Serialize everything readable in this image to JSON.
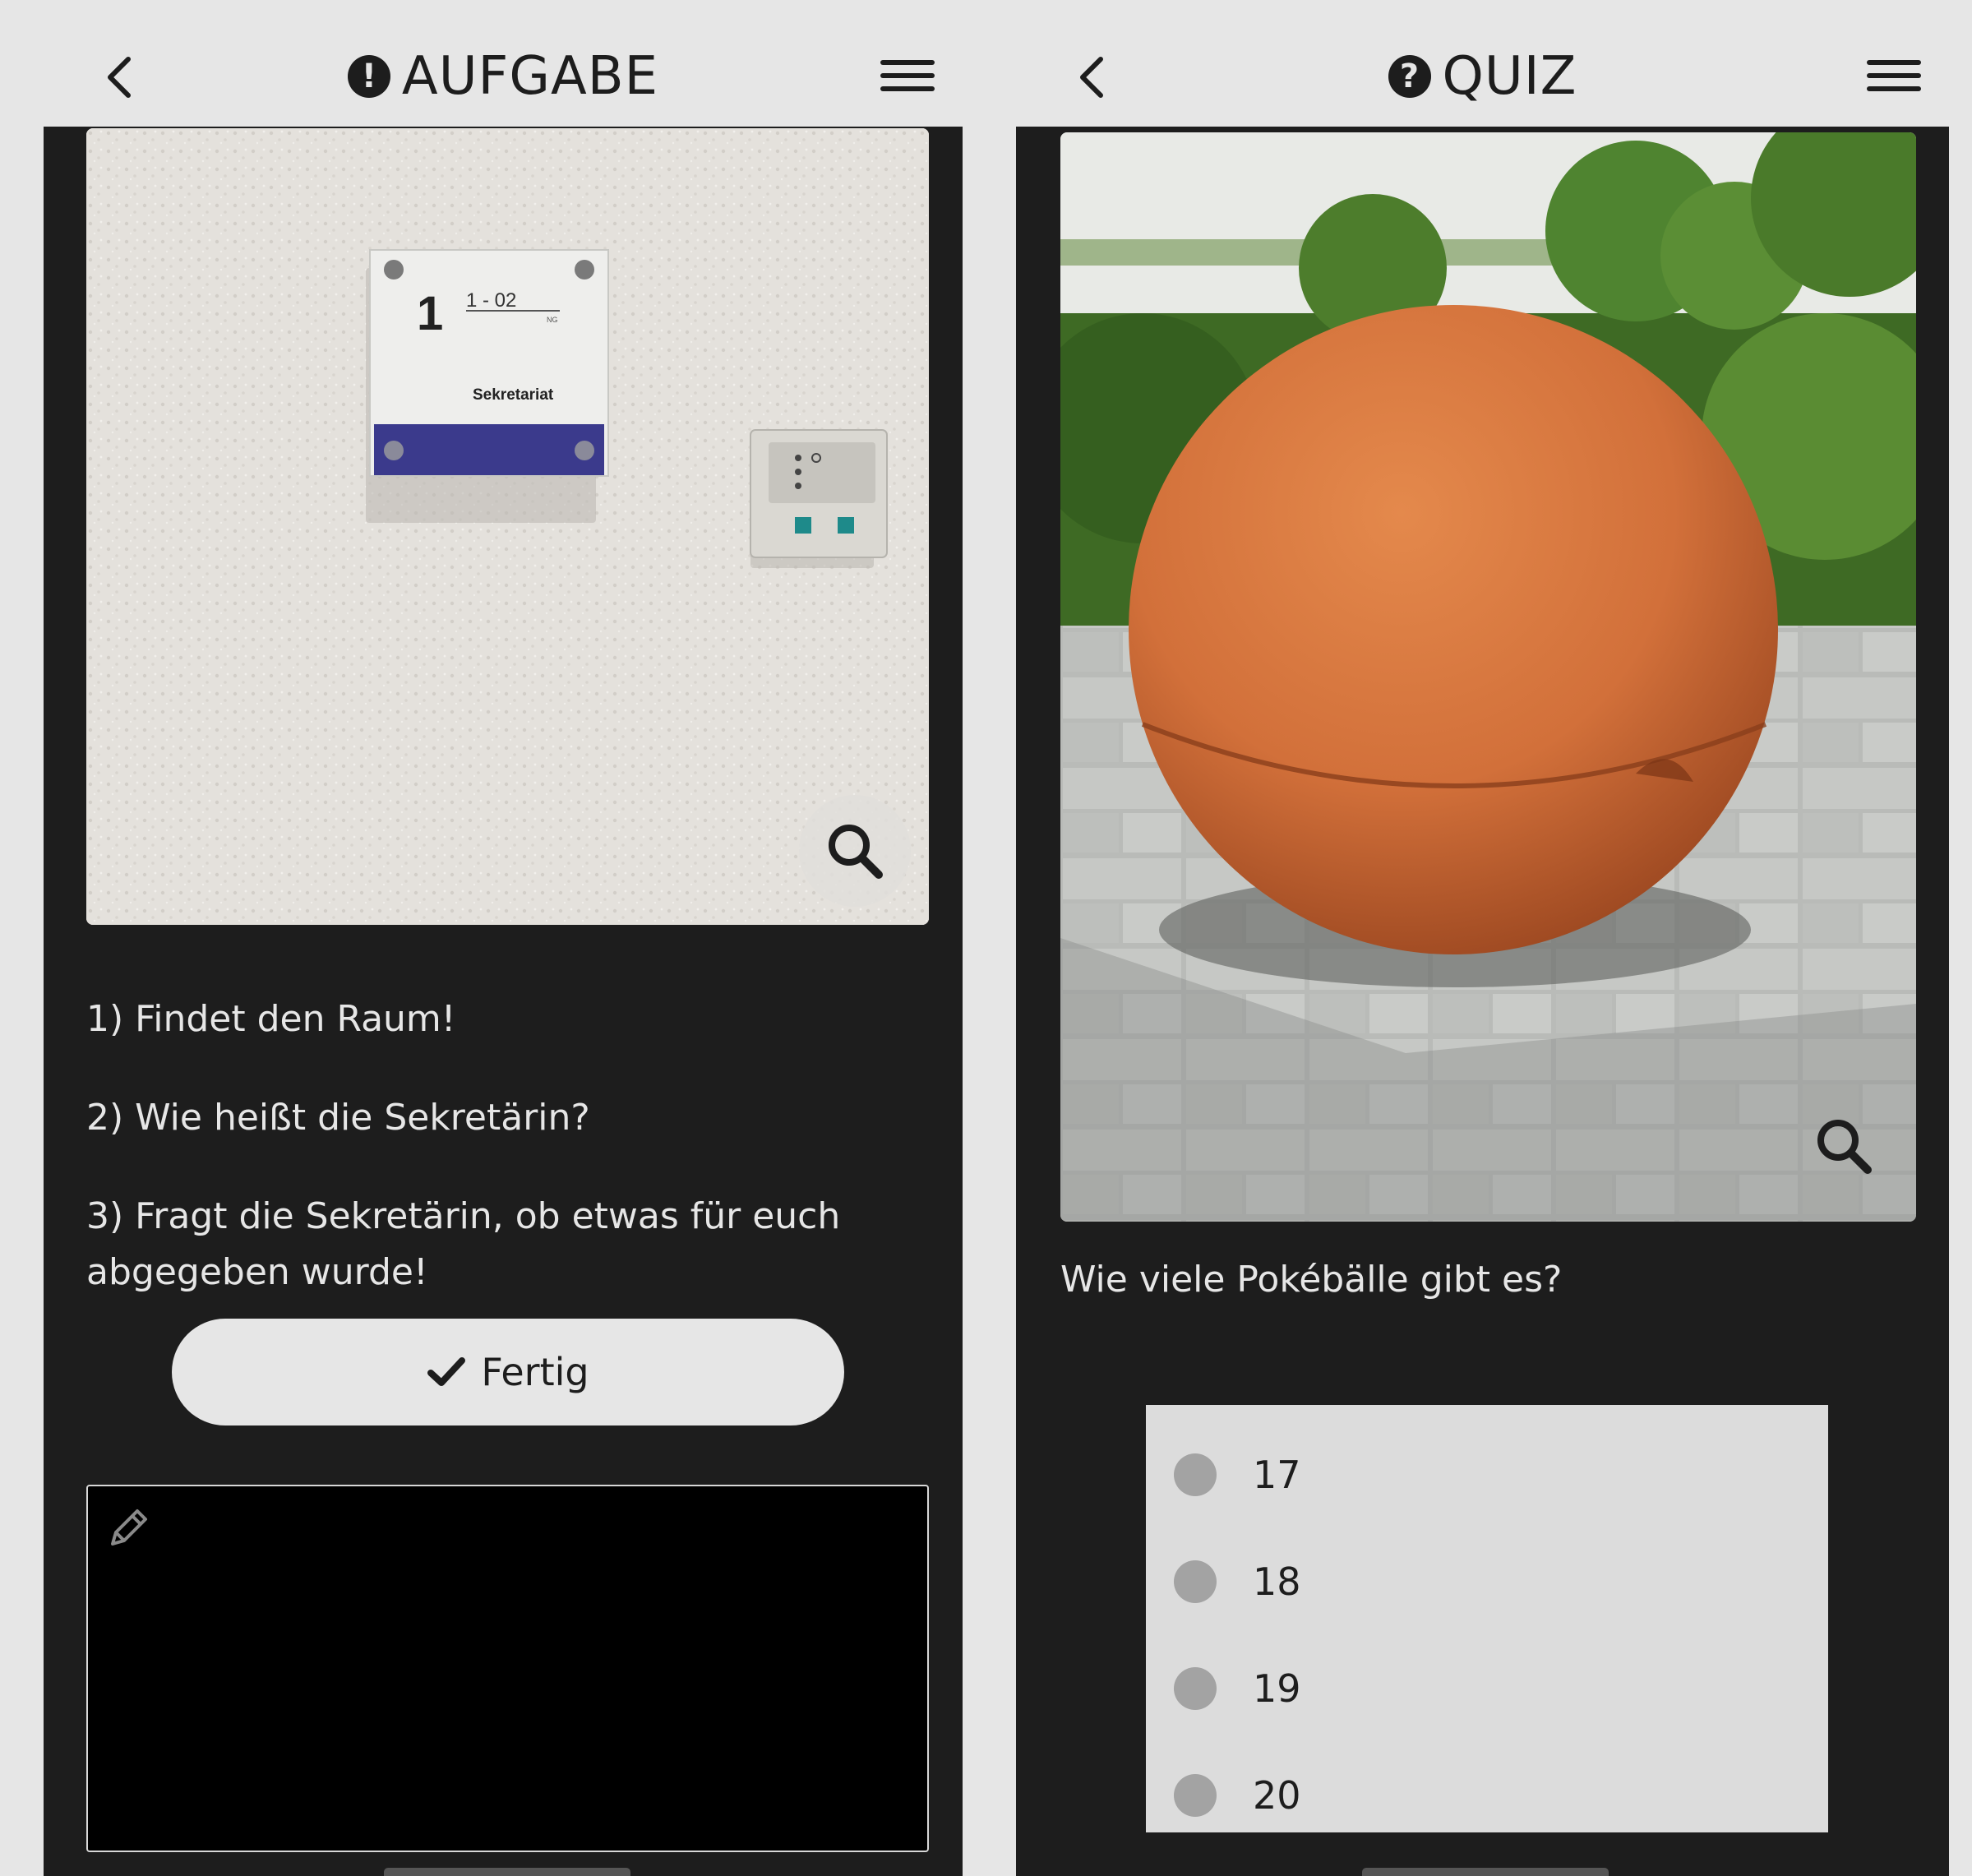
{
  "left_screen": {
    "title": "AUFGABE",
    "title_icon": "exclamation-circle-icon",
    "photo_sign": {
      "floor": "1",
      "room": "1 - 02",
      "subtext": "NG",
      "label": "Sekretariat"
    },
    "tasks": [
      "1) Findet den Raum!",
      "2) Wie heißt die Sekretärin?",
      "3) Fragt die Sekretärin, ob etwas für euch abgegeben wurde!"
    ],
    "done_label": "Fertig",
    "notes_value": ""
  },
  "right_screen": {
    "title": "QUIZ",
    "title_icon": "question-circle-icon",
    "question": "Wie viele Pokébälle gibt es?",
    "options": [
      "17",
      "18",
      "19",
      "20"
    ]
  },
  "colors": {
    "header_bg": "#e6e6e6",
    "screen_bg": "#1d1d1d",
    "text_light": "#e6e6e6",
    "sphere": "#d67a45"
  }
}
